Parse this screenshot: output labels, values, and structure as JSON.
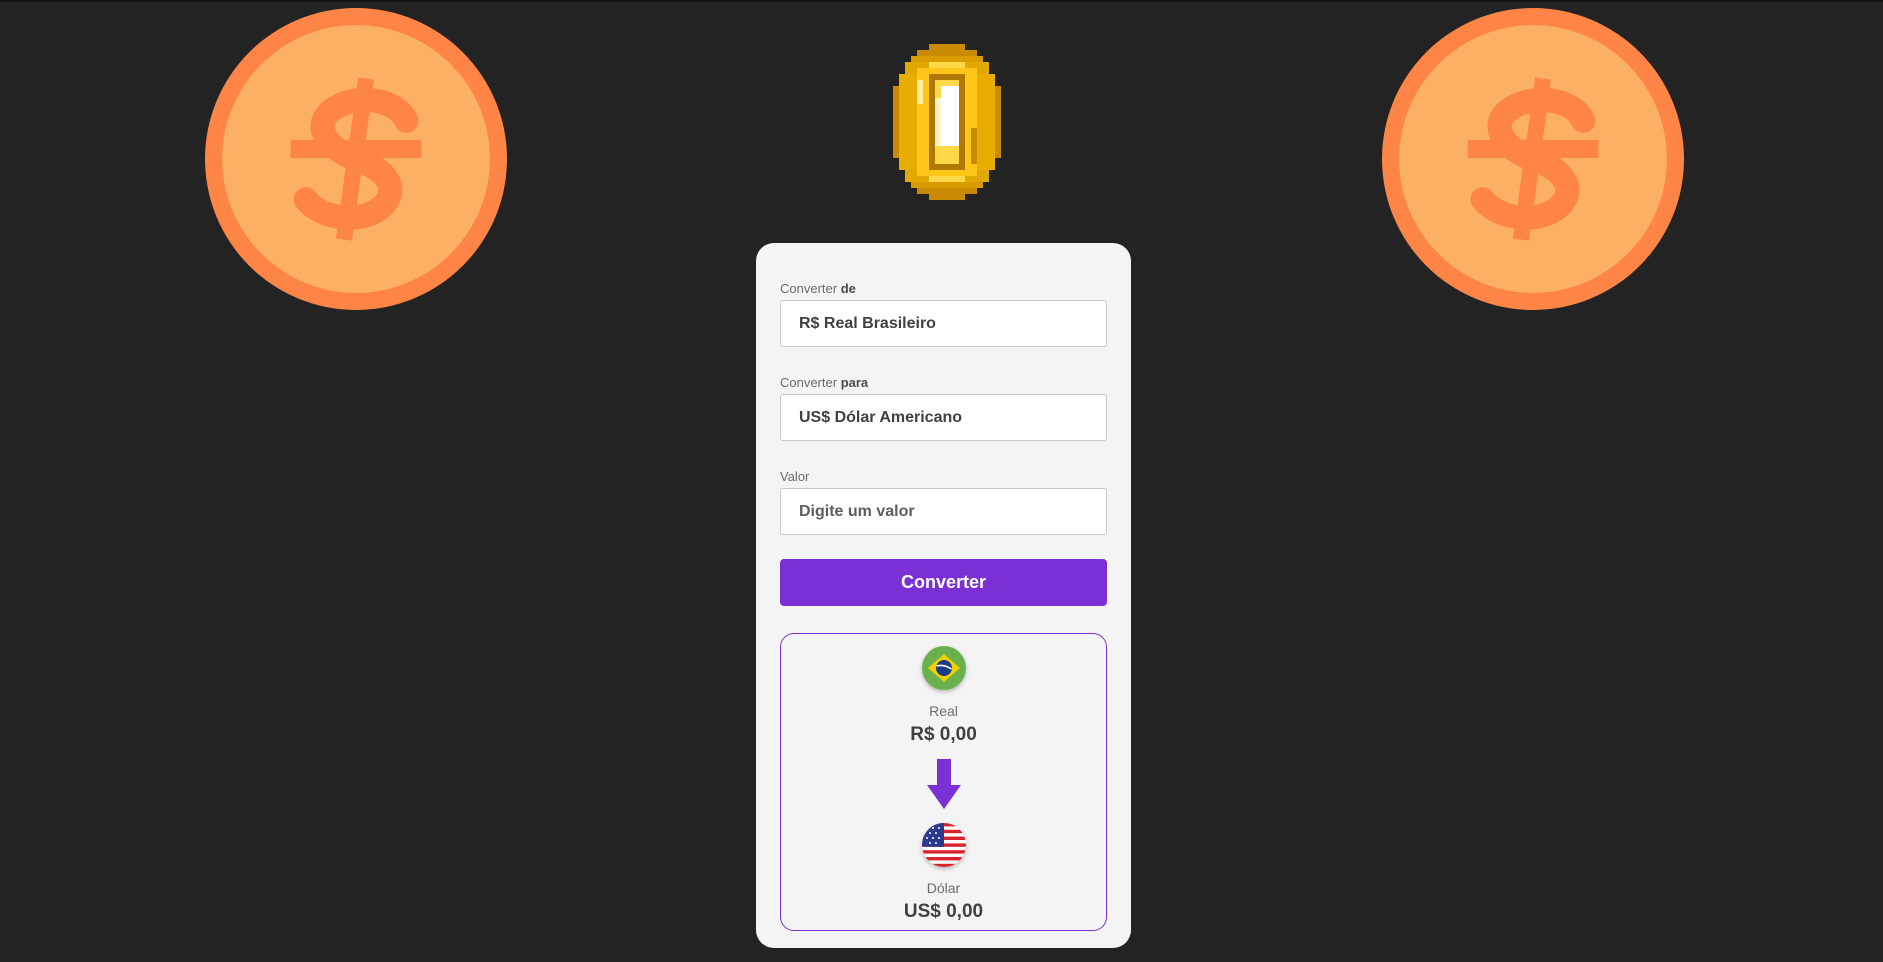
{
  "form": {
    "from": {
      "label_prefix": "Converter",
      "label_bold": "de",
      "selected": "R$ Real Brasileiro"
    },
    "to": {
      "label_prefix": "Converter",
      "label_bold": "para",
      "selected": "US$ Dólar Americano"
    },
    "amount": {
      "label": "Valor",
      "placeholder": "Digite um valor",
      "value": ""
    },
    "submit_label": "Converter"
  },
  "result": {
    "source": {
      "flag": "brazil-flag-icon",
      "name": "Real",
      "value": "R$ 0,00"
    },
    "arrow": "arrow-down-icon",
    "target": {
      "flag": "usa-flag-icon",
      "name": "Dólar",
      "value": "US$ 0,00"
    }
  },
  "decorations": {
    "left_coin": "dollar-coin-icon",
    "right_coin": "dollar-coin-icon",
    "center_coin": "pixel-gold-coin-icon"
  },
  "colors": {
    "background": "#232323",
    "panel": "#f4f4f5",
    "accent": "#7a30d4",
    "coin_outer": "#ff8546",
    "coin_inner": "#fbb063",
    "gold": "#f5b400"
  }
}
